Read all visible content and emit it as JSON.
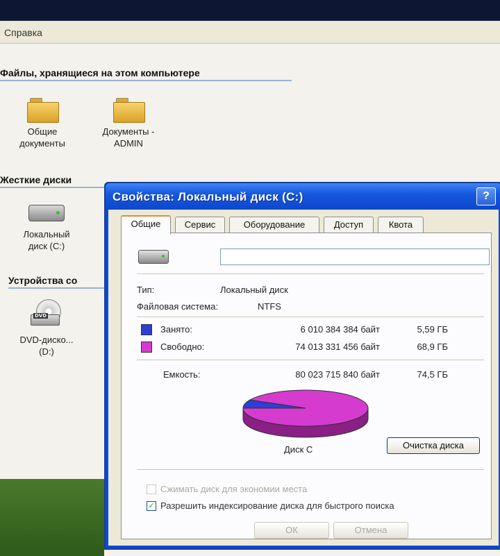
{
  "menubar": {
    "help": "Справка"
  },
  "explorer": {
    "files_group": "Файлы, хранящиеся на этом компьютере",
    "folders": [
      {
        "label_line1": "Общие",
        "label_line2": "документы"
      },
      {
        "label_line1": "Документы -",
        "label_line2": "ADMIN"
      }
    ],
    "hard_disks_group": "Жесткие диски",
    "local_disk": {
      "label_line1": "Локальный",
      "label_line2": "диск (C:)"
    },
    "devices_group": "Устройства со",
    "dvd": {
      "label_line1": "DVD-диско...",
      "label_line2": "(D:)"
    }
  },
  "dialog": {
    "title": "Свойства: Локальный диск (C:)",
    "help_button": "?",
    "tabs": [
      "Общие",
      "Сервис",
      "Оборудование",
      "Доступ",
      "Квота"
    ],
    "active_tab": "Общие",
    "volume_name": "",
    "type_label": "Тип:",
    "type_value": "Локальный диск",
    "fs_label": "Файловая система:",
    "fs_value": "NTFS",
    "used": {
      "label": "Занято:",
      "bytes": "6 010 384 384 байт",
      "size": "5,59 ГБ",
      "color": "#2b3fd6"
    },
    "free": {
      "label": "Свободно:",
      "bytes": "74 013 331 456 байт",
      "size": "68,9 ГБ",
      "color": "#d63bd0"
    },
    "capacity": {
      "label": "Емкость:",
      "bytes": "80 023 715 840 байт",
      "size": "74,5 ГБ"
    },
    "used_fraction": 0.075,
    "disk_label": "Диск C",
    "cleanup_button": "Очистка диска",
    "compress_label": "Сжимать диск для экономии места",
    "compress_checked": false,
    "index_label": "Разрешить индексирование диска для быстрого поиска",
    "index_checked": true,
    "ok_button": "ОК",
    "cancel_button": "Отмена"
  }
}
